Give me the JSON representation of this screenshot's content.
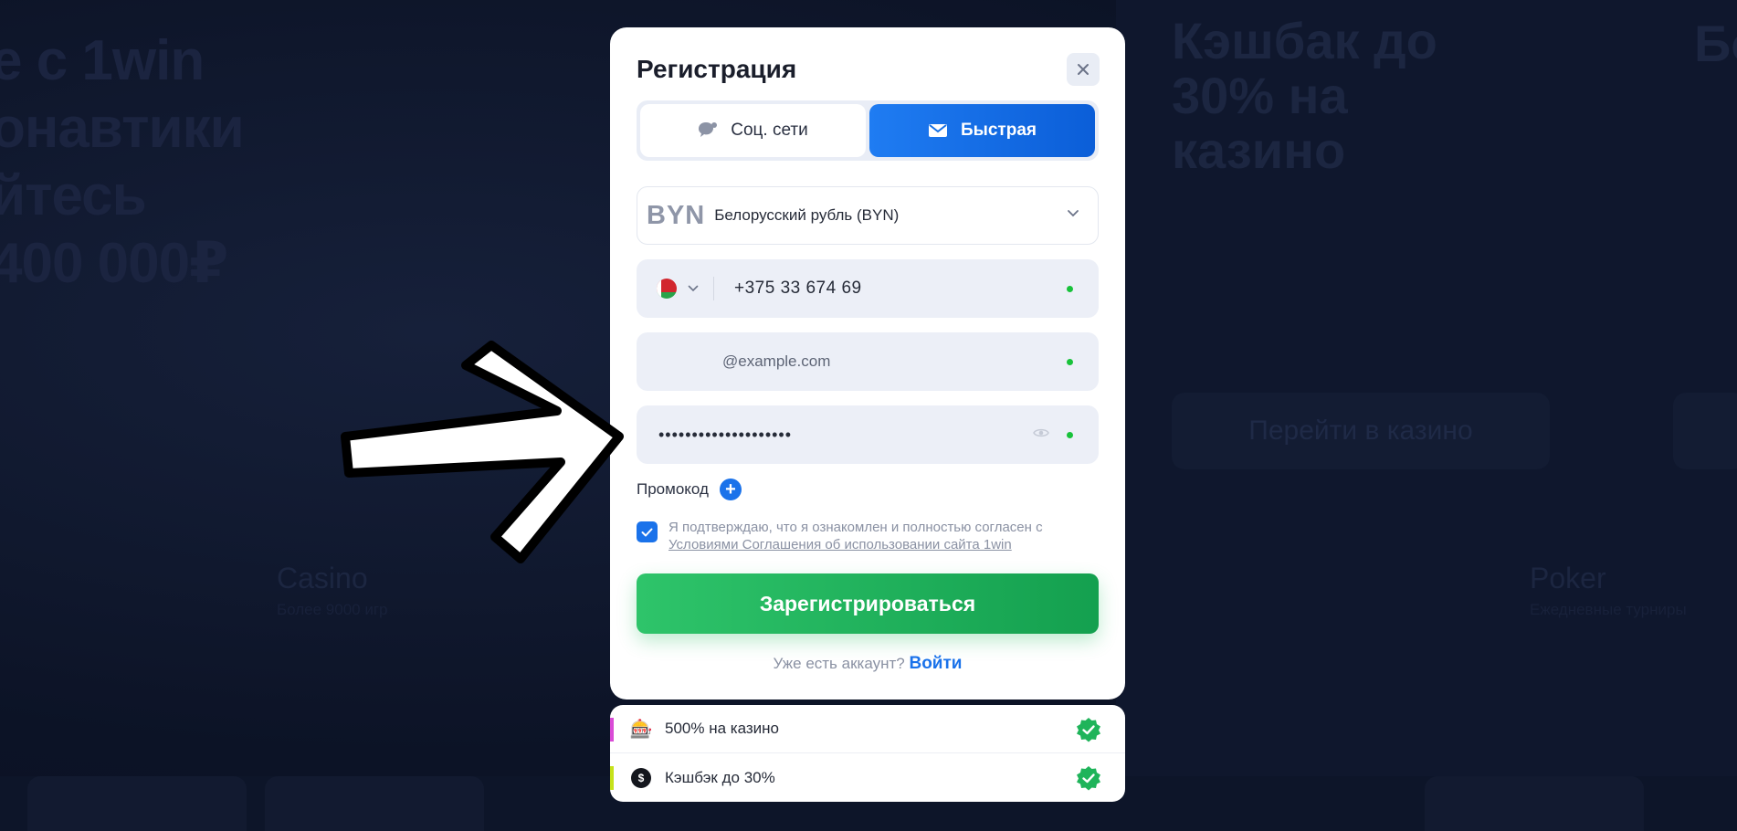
{
  "background": {
    "hero_text": "е с 1win\nонавтики\nйтесь\n400 000₽",
    "cashback_text": "Кэшбак до\n30% на\nказино",
    "right_title": "Бо",
    "go_casino_button": "Перейти в казино",
    "casino_label": "Casino",
    "casino_sub": "Более 9000 игр",
    "poker_label": "Poker",
    "poker_sub": "Ежедневные турниры"
  },
  "modal": {
    "title": "Регистрация",
    "close_icon": "close-icon",
    "tabs": [
      {
        "label": "Соц. сети",
        "icon": "chat-bubble-icon",
        "active": false
      },
      {
        "label": "Быстрая",
        "icon": "envelope-icon",
        "active": true
      }
    ],
    "currency": {
      "code": "BYN",
      "name": "Белорусский рубль (BYN)"
    },
    "phone": {
      "country": "BY",
      "value": "+375 33 674 69",
      "value_faded": " "
    },
    "email": {
      "value_hidden": " ",
      "value": "@example.com"
    },
    "password": {
      "masked": "••••••••••••••••••••"
    },
    "promo_label": "Промокод",
    "agreement": {
      "text": "Я подтверждаю, что я ознакомлен и полностью согласен с",
      "link": "Условиями Соглашения об использовании сайта 1win",
      "checked": true
    },
    "register_button": "Зарегистрироваться",
    "login_prompt": "Уже есть аккаунт?",
    "login_link": "Войти"
  },
  "bonuses": [
    {
      "label": "500% на казино",
      "icon": "slot-machine-icon",
      "accent": "#d94bd6"
    },
    {
      "label": "Кэшбэк до 30%",
      "icon": "coin-icon",
      "accent": "#c6e21b"
    }
  ],
  "colors": {
    "primary": "#1a72ea",
    "success": "#1fb45a",
    "backdrop": "#0b1224"
  }
}
